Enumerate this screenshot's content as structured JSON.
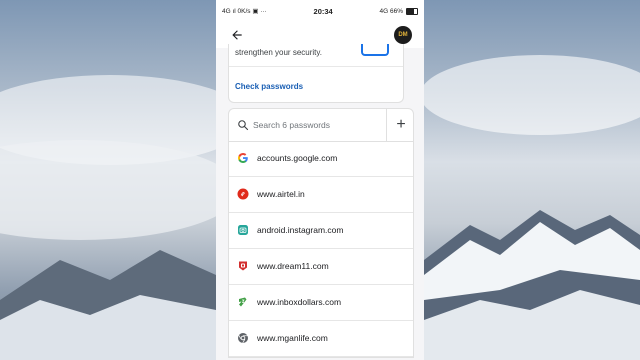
{
  "status_bar": {
    "left_text": "4G ıl 0K/s ▣ ···",
    "time": "20:34",
    "right_text": "4G 66%"
  },
  "profile": {
    "avatar_label": "DM"
  },
  "security_card": {
    "description": "strengthen your security.",
    "action": "Check passwords"
  },
  "search": {
    "placeholder": "Search 6 passwords"
  },
  "passwords": [
    {
      "site": "accounts.google.com",
      "icon": "google-icon"
    },
    {
      "site": "www.airtel.in",
      "icon": "airtel-icon"
    },
    {
      "site": "android.instagram.com",
      "icon": "instagram-icon"
    },
    {
      "site": "www.dream11.com",
      "icon": "dream11-icon"
    },
    {
      "site": "www.inboxdollars.com",
      "icon": "inboxdollars-icon"
    },
    {
      "site": "www.mganlife.com",
      "icon": "globe-icon"
    }
  ],
  "colors": {
    "link_blue": "#1a5fb4",
    "google_blue": "#4285f4",
    "airtel_red": "#e02a1b",
    "instagram_teal": "#26a69a",
    "dream11_red": "#d32f2f",
    "inboxdollars_green": "#43a047"
  }
}
